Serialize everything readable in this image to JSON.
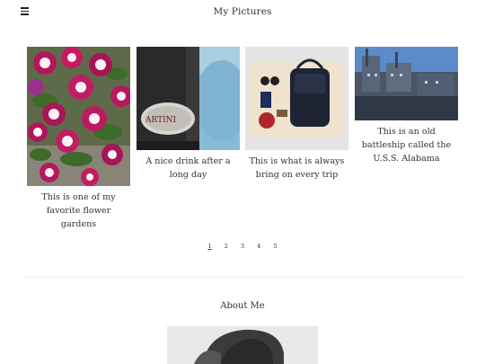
{
  "header": {
    "title": "My Pictures",
    "menu_icon": "hamburger-menu-icon"
  },
  "gallery": {
    "items": [
      {
        "caption": "This is one of my favorite flower gardens",
        "image": "flower-garden-photo"
      },
      {
        "caption": "A nice drink after a long day",
        "image": "martini-bottle-photo"
      },
      {
        "caption": "This is what is always bring on every trip",
        "image": "travel-bag-photo"
      },
      {
        "caption": "This is an old battleship called the U.S.S. Alabama",
        "image": "battleship-photo"
      }
    ]
  },
  "pagination": {
    "pages": [
      "1",
      "2",
      "3",
      "4",
      "5"
    ],
    "current": "1"
  },
  "about": {
    "title": "About Me",
    "photo": "profile-photo"
  },
  "colors": {
    "text": "#333333",
    "background": "#ffffff",
    "divider": "#eeeeee"
  }
}
